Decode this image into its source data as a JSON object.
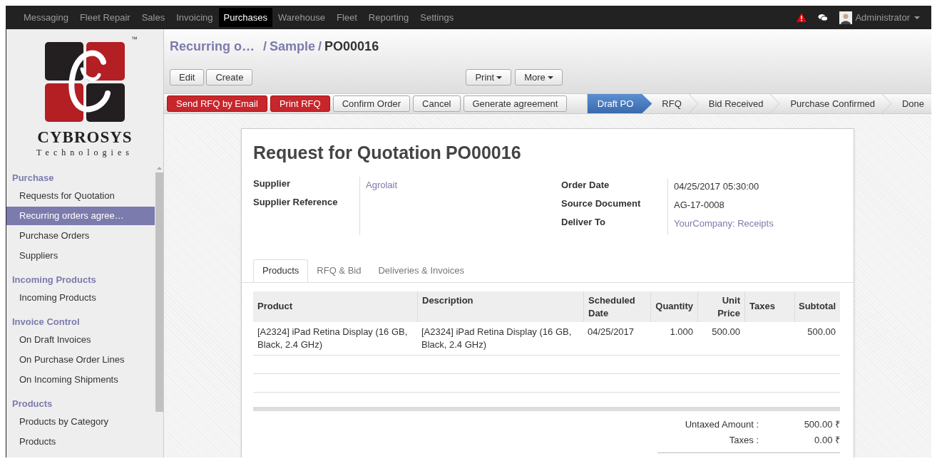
{
  "top_menu": [
    {
      "label": "Messaging",
      "selected": false
    },
    {
      "label": "Fleet Repair",
      "selected": false
    },
    {
      "label": "Sales",
      "selected": false
    },
    {
      "label": "Invoicing",
      "selected": false
    },
    {
      "label": "Purchases",
      "selected": true
    },
    {
      "label": "Warehouse",
      "selected": false
    },
    {
      "label": "Fleet",
      "selected": false
    },
    {
      "label": "Reporting",
      "selected": false
    },
    {
      "label": "Settings",
      "selected": false
    }
  ],
  "user": {
    "name": "Administrator"
  },
  "sidebar": {
    "logo": {
      "trademark": "™",
      "name": "CYBROSYS",
      "tagline": "Technologies"
    },
    "sections": [
      {
        "title": "Purchase",
        "items": [
          {
            "label": "Requests for Quotation",
            "selected": false
          },
          {
            "label": "Recurring orders agree…",
            "selected": true
          },
          {
            "label": "Purchase Orders",
            "selected": false
          },
          {
            "label": "Suppliers",
            "selected": false
          }
        ]
      },
      {
        "title": "Incoming Products",
        "items": [
          {
            "label": "Incoming Products",
            "selected": false
          }
        ]
      },
      {
        "title": "Invoice Control",
        "items": [
          {
            "label": "On Draft Invoices",
            "selected": false
          },
          {
            "label": "On Purchase Order Lines",
            "selected": false
          },
          {
            "label": "On Incoming Shipments",
            "selected": false
          }
        ]
      },
      {
        "title": "Products",
        "items": [
          {
            "label": "Products by Category",
            "selected": false
          },
          {
            "label": "Products",
            "selected": false
          }
        ]
      }
    ]
  },
  "breadcrumb": [
    {
      "label": "Recurring o…",
      "kind": "link"
    },
    {
      "separator": "/",
      "label": "Sample",
      "kind": "link"
    },
    {
      "separator": "/",
      "label": "PO00016",
      "kind": "current"
    }
  ],
  "view_buttons": [
    "Edit",
    "Create"
  ],
  "action_menus": [
    "Print",
    "More"
  ],
  "workflow_buttons": [
    {
      "label": "Send RFQ by Email",
      "kind": "primary"
    },
    {
      "label": "Print RFQ",
      "kind": "primary"
    },
    {
      "label": "Confirm Order",
      "kind": "default"
    },
    {
      "label": "Cancel",
      "kind": "default"
    },
    {
      "label": "Generate agreement",
      "kind": "default"
    }
  ],
  "stages": [
    {
      "label": "Draft PO",
      "selected": true
    },
    {
      "label": "RFQ",
      "selected": false
    },
    {
      "label": "Bid Received",
      "selected": false
    },
    {
      "label": "Purchase Confirmed",
      "selected": false
    },
    {
      "label": "Done",
      "selected": false
    }
  ],
  "form": {
    "title": "Request for Quotation",
    "number": "PO00016",
    "left_fields": [
      {
        "label": "Supplier",
        "value": "Agrolait",
        "kind": "link"
      },
      {
        "label": "Supplier Reference"
      }
    ],
    "right_fields": [
      {
        "label": "Order Date",
        "value": "04/25/2017 05:30:00",
        "kind": "text"
      },
      {
        "label": "Source Document",
        "value": "AG-17-0008",
        "kind": "text"
      },
      {
        "label": "Deliver To",
        "value": "YourCompany: Receipts",
        "kind": "link"
      }
    ]
  },
  "tabs": [
    {
      "label": "Products",
      "selected": true
    },
    {
      "label": "RFQ & Bid",
      "selected": false
    },
    {
      "label": "Deliveries & Invoices",
      "selected": false
    }
  ],
  "table": {
    "columns": [
      {
        "label": "Product"
      },
      {
        "label": "Description"
      },
      {
        "label": "Scheduled Date"
      },
      {
        "label": "Quantity"
      },
      {
        "label": "Unit Price"
      },
      {
        "label": "Taxes"
      },
      {
        "label": "Subtotal"
      }
    ],
    "rows": [
      {
        "cells": [
          "[A2324] iPad Retina Display (16 GB, Black, 2.4 GHz)",
          "[A2324] iPad Retina Display (16 GB, Black, 2.4 GHz)",
          "04/25/2017",
          "1.000",
          "500.00",
          "",
          "500.00"
        ]
      }
    ]
  },
  "totals": [
    {
      "label": "Untaxed Amount :",
      "value": "500.00 ₹"
    },
    {
      "label": "Taxes :",
      "value": "0.00 ₹"
    }
  ]
}
